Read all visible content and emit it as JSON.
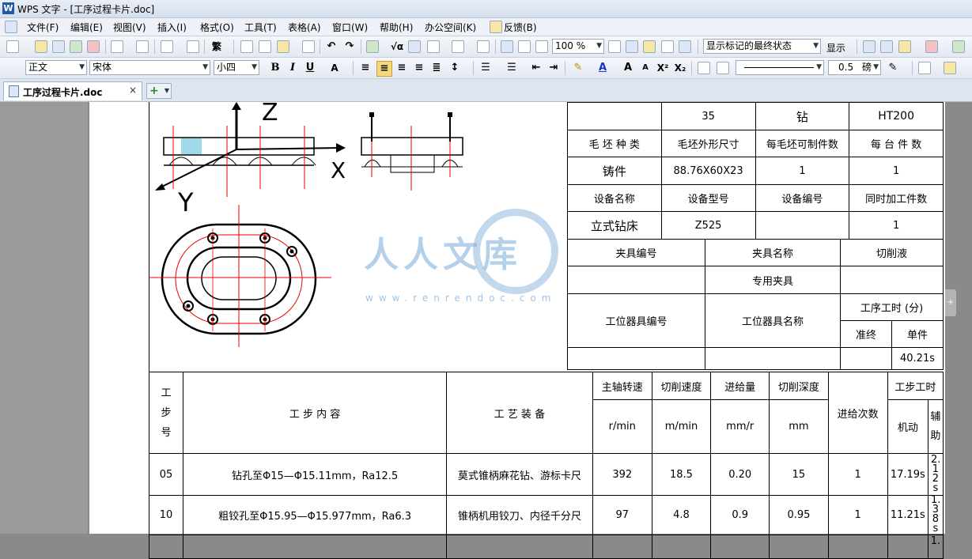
{
  "window": {
    "title": "WPS 文字 - [工序过程卡片.doc]",
    "app_icon": "W"
  },
  "menu": [
    "文件(F)",
    "编辑(E)",
    "视图(V)",
    "插入(I)",
    "格式(O)",
    "工具(T)",
    "表格(A)",
    "窗口(W)",
    "帮助(H)",
    "办公空间(K)",
    "反馈(B)"
  ],
  "toolbar": {
    "zoom": "100 %",
    "markup_state": "显示标记的最终状态",
    "show_label": "显示"
  },
  "format": {
    "style": "正文",
    "font": "宋体",
    "size": "小四",
    "line_weight": "0.5",
    "line_unit": "磅"
  },
  "tabs": {
    "doc_name": "工序过程卡片.doc",
    "close": "×",
    "add": "+"
  },
  "drawing": {
    "axis_z": "Z",
    "axis_x": "X",
    "axis_y": "Y"
  },
  "watermark": {
    "text": "人人文库",
    "url": "www.renrendoc.com"
  },
  "info_table": {
    "r0": [
      "35",
      "钻",
      "HT200"
    ],
    "r1": [
      "毛 坯 种 类",
      "毛坯外形尺寸",
      "每毛坯可制件数",
      "每 台 件 数"
    ],
    "r2": [
      "铸件",
      "88.76X60X23",
      "1",
      "1"
    ],
    "r3": [
      "设备名称",
      "设备型号",
      "设备编号",
      "同时加工件数"
    ],
    "r4": [
      "立式钻床",
      "Z525",
      "",
      "1"
    ]
  },
  "fixture_table": {
    "h": [
      "夹具编号",
      "夹具名称",
      "切削液"
    ],
    "fixture_name": "专用夹具",
    "station_code": "工位器具编号",
    "station_name": "工位器具名称",
    "time_label": "工序工时 (分)",
    "prep": "准终",
    "unit": "单件",
    "unit_value": "40.21s"
  },
  "steps_table": {
    "headers": {
      "step_no": "工步号",
      "content": "工 步 内 容",
      "equipment": "工 艺 装 备",
      "spindle": "主轴转速",
      "cut_speed": "切削速度",
      "feed": "进给量",
      "depth": "切削深度",
      "passes": "进给次数",
      "hours": "工步工时",
      "u_spindle": "r/min",
      "u_speed": "m/min",
      "u_feed": "mm/r",
      "u_depth": "mm",
      "machine": "机动",
      "aux": "辅助"
    },
    "rows": [
      {
        "no": "05",
        "content": "钻孔至Φ15—Φ15.11mm，Ra12.5",
        "equip": "莫式锥柄麻花钻、游标卡尺",
        "spindle": "392",
        "speed": "18.5",
        "feed": "0.20",
        "depth": "15",
        "passes": "1",
        "machine": "17.19s",
        "aux": "2.12s"
      },
      {
        "no": "10",
        "content": "粗铰孔至Φ15.95—Φ15.977mm，Ra6.3",
        "equip": "锥柄机用铰刀、内径千分尺",
        "spindle": "97",
        "speed": "4.8",
        "feed": "0.9",
        "depth": "0.95",
        "passes": "1",
        "machine": "11.21s",
        "aux": "1.38s"
      },
      {
        "no": "",
        "content": "",
        "equip": "",
        "spindle": "",
        "speed": "",
        "feed": "",
        "depth": "",
        "passes": "",
        "machine": "",
        "aux": "1."
      }
    ]
  }
}
